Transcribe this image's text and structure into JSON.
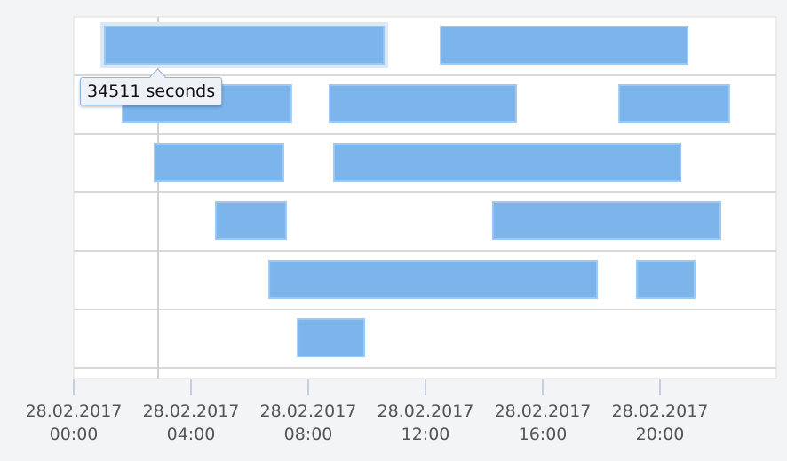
{
  "chart_data": {
    "type": "gantt",
    "title": "",
    "xlabel": "",
    "ylabel": "",
    "x_unit": "hours",
    "xlim": [
      0,
      24
    ],
    "x_ticks": [
      {
        "value": 0,
        "date": "28.02.2017",
        "time": "00:00"
      },
      {
        "value": 4,
        "date": "28.02.2017",
        "time": "04:00"
      },
      {
        "value": 8,
        "date": "28.02.2017",
        "time": "08:00"
      },
      {
        "value": 12,
        "date": "28.02.2017",
        "time": "12:00"
      },
      {
        "value": 16,
        "date": "28.02.2017",
        "time": "16:00"
      },
      {
        "value": 20,
        "date": "28.02.2017",
        "time": "20:00"
      }
    ],
    "grid": true,
    "crosshair_x": 2.88,
    "rows": [
      {
        "segments": [
          [
            1.06,
            10.58
          ],
          [
            12.52,
            20.94
          ]
        ]
      },
      {
        "segments": [
          [
            1.67,
            7.42
          ],
          [
            8.73,
            15.09
          ],
          [
            18.61,
            22.36
          ]
        ]
      },
      {
        "segments": [
          [
            2.76,
            7.15
          ],
          [
            8.88,
            20.7
          ]
        ]
      },
      {
        "segments": [
          [
            4.85,
            7.24
          ],
          [
            14.3,
            22.06
          ]
        ]
      },
      {
        "segments": [
          [
            6.67,
            17.85
          ],
          [
            19.21,
            21.18
          ]
        ]
      },
      {
        "segments": [
          [
            7.64,
            9.91
          ]
        ]
      }
    ],
    "highlighted": {
      "row": 0,
      "segment": 0
    },
    "tooltip": "34511 seconds",
    "colors": {
      "bar": "#7cb5ec",
      "bar_border": "#9cc8f2",
      "highlight_halo": "#d9e9f9",
      "grid": "#d8d8d8",
      "tick": "#c0d0e0"
    }
  }
}
